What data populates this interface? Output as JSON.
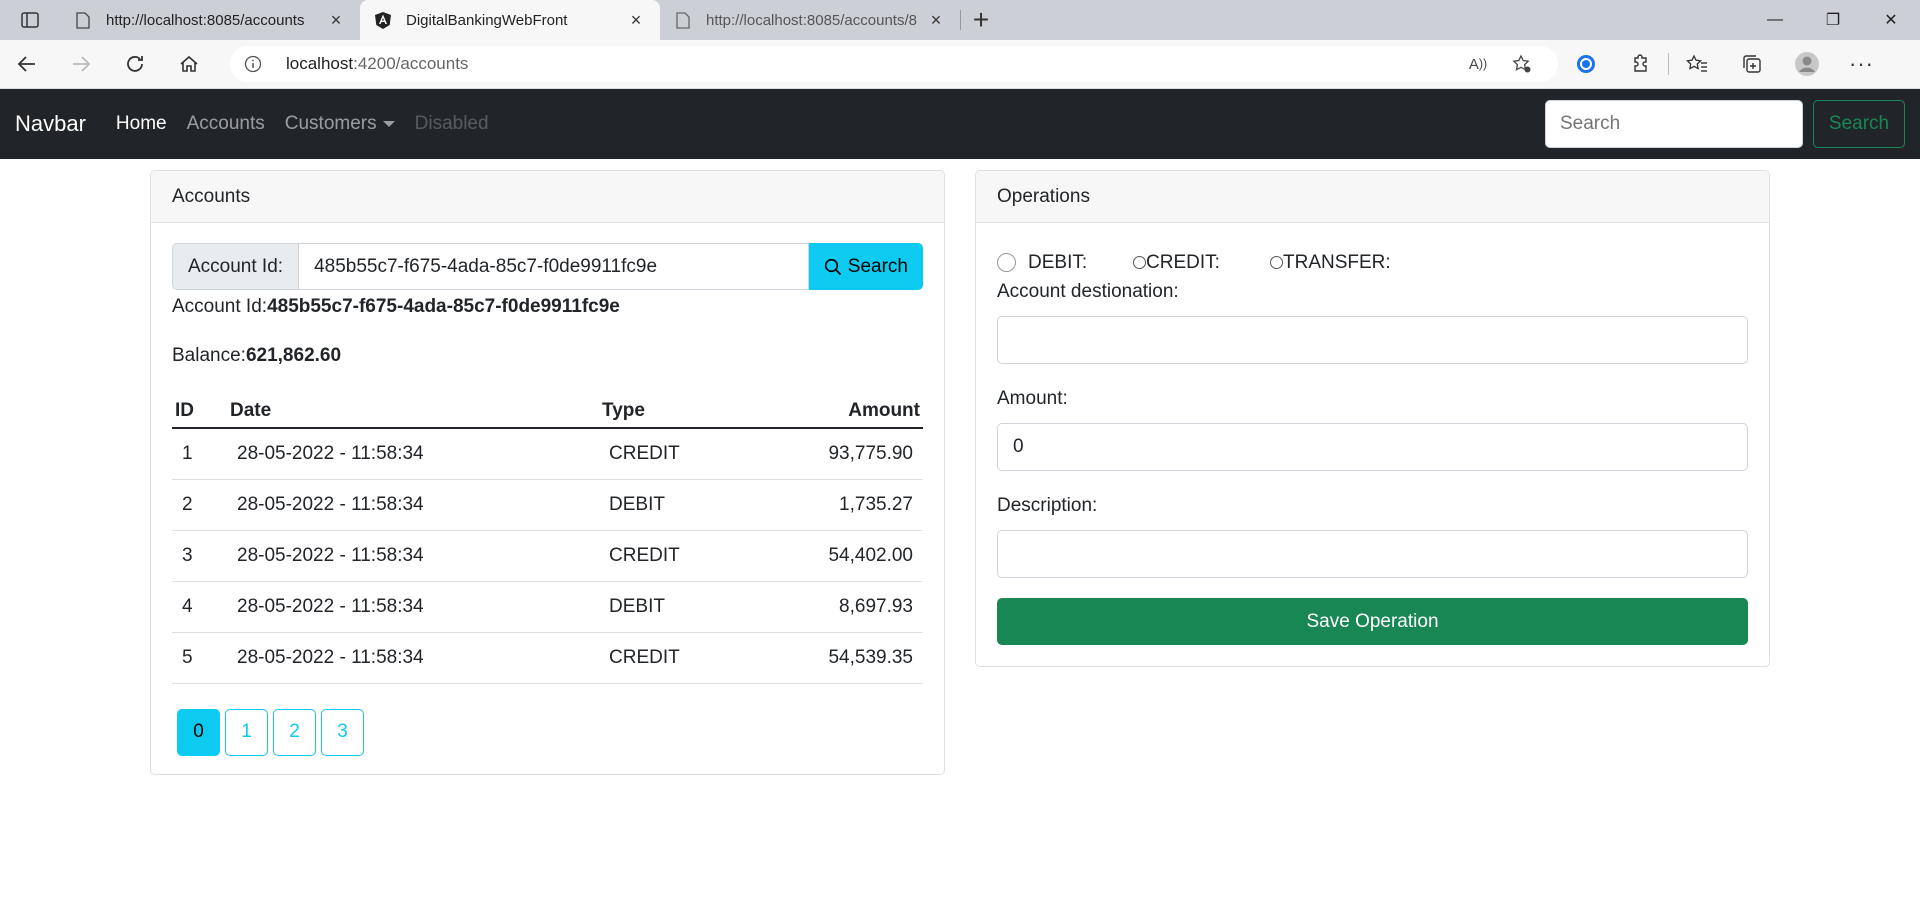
{
  "browser": {
    "tabs": [
      {
        "title": "http://localhost:8085/accounts",
        "icon": "page-icon",
        "active": false
      },
      {
        "title": "DigitalBankingWebFront",
        "icon": "angular-icon",
        "active": true
      },
      {
        "title": "http://localhost:8085/accounts/8",
        "icon": "page-icon",
        "active": false
      }
    ],
    "url_host": "localhost",
    "url_path": ":4200/accounts"
  },
  "navbar": {
    "brand": "Navbar",
    "links": [
      {
        "label": "Home",
        "state": "active"
      },
      {
        "label": "Accounts",
        "state": "normal"
      },
      {
        "label": "Customers",
        "state": "dropdown"
      },
      {
        "label": "Disabled",
        "state": "disabled"
      }
    ],
    "search_placeholder": "Search",
    "search_button": "Search"
  },
  "accounts": {
    "header": "Accounts",
    "account_id_label": "Account Id:",
    "account_id_value": "485b55c7-f675-4ada-85c7-f0de9911fc9e",
    "search_button": "Search",
    "info_label": "Account Id:",
    "info_value": "485b55c7-f675-4ada-85c7-f0de9911fc9e",
    "balance_label": "Balance:",
    "balance_value": "621,862.60",
    "columns": [
      "ID",
      "Date",
      "Type",
      "Amount"
    ],
    "rows": [
      {
        "id": "1",
        "date": "28-05-2022 - 11:58:34",
        "type": "CREDIT",
        "amount": "93,775.90"
      },
      {
        "id": "2",
        "date": "28-05-2022 - 11:58:34",
        "type": "DEBIT",
        "amount": "1,735.27"
      },
      {
        "id": "3",
        "date": "28-05-2022 - 11:58:34",
        "type": "CREDIT",
        "amount": "54,402.00"
      },
      {
        "id": "4",
        "date": "28-05-2022 - 11:58:34",
        "type": "DEBIT",
        "amount": "8,697.93"
      },
      {
        "id": "5",
        "date": "28-05-2022 - 11:58:34",
        "type": "CREDIT",
        "amount": "54,539.35"
      }
    ],
    "pages": [
      "0",
      "1",
      "2",
      "3"
    ],
    "current_page": "0"
  },
  "operations": {
    "header": "Operations",
    "radio_debit": "DEBIT:",
    "radio_credit": "CREDIT:",
    "radio_transfer": "TRANSFER:",
    "destination_label": "Account destionation:",
    "destination_value": "",
    "amount_label": "Amount:",
    "amount_value": "0",
    "description_label": "Description:",
    "description_value": "",
    "save_button": "Save Operation"
  },
  "colors": {
    "navbar_bg": "#212529",
    "info": "#0dcaf0",
    "success": "#198754"
  }
}
